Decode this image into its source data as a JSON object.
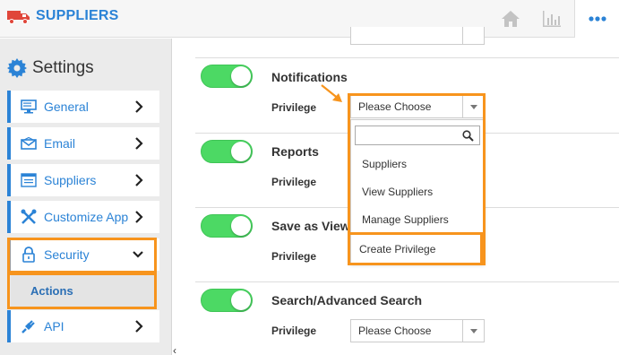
{
  "header": {
    "brand_title": "SUPPLIERS",
    "brand_icon": "truck-icon",
    "home_icon": "home-icon",
    "reports_icon": "bar-chart-icon",
    "more_icon": "ellipsis-icon"
  },
  "sidebar": {
    "title": "Settings",
    "title_icon": "gear-icon",
    "items": [
      {
        "label": "General",
        "icon": "monitor-icon"
      },
      {
        "label": "Email",
        "icon": "envelope-icon"
      },
      {
        "label": "Suppliers",
        "icon": "list-window-icon"
      },
      {
        "label": "Customize App",
        "icon": "tools-icon"
      },
      {
        "label": "Security",
        "icon": "lock-icon"
      },
      {
        "label": "API",
        "icon": "plug-icon"
      }
    ],
    "sub_item": "Actions"
  },
  "features": [
    {
      "name": "Notifications",
      "privilege_label": "Privilege",
      "select_value": "Please Choose",
      "enabled": true
    },
    {
      "name": "Reports",
      "privilege_label": "Privilege",
      "enabled": true
    },
    {
      "name": "Save as View",
      "privilege_label": "Privilege",
      "enabled": true
    },
    {
      "name": "Search/Advanced Search",
      "privilege_label": "Privilege",
      "select_value": "Please Choose",
      "enabled": true
    }
  ],
  "dropdown": {
    "search_placeholder": "",
    "options": [
      "Suppliers",
      "View Suppliers",
      "Manage Suppliers"
    ],
    "create_label": "Create Privilege"
  },
  "colors": {
    "accent": "#2b83d6",
    "highlight": "#f7941d",
    "toggle_on": "#4cd964"
  }
}
